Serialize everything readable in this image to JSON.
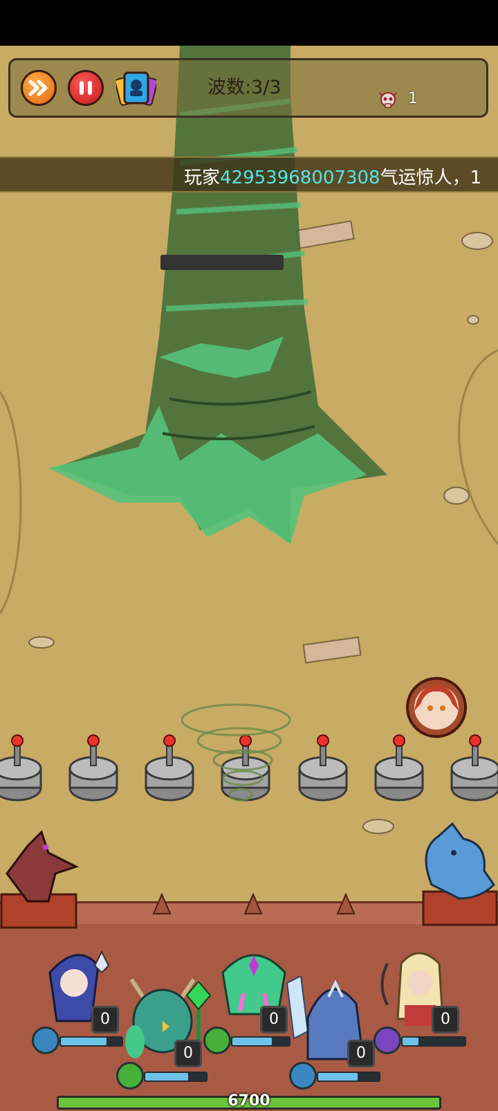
{
  "hud": {
    "wave_label": "波数:3/3",
    "kill_count": "1"
  },
  "ticker": {
    "prefix": "玩家",
    "player_id": "42953968007308",
    "suffix": "气运惊人，",
    "tail": "1"
  },
  "heroes": [
    {
      "name": "mage",
      "count": "0",
      "mana": 0.75
    },
    {
      "name": "antler-beast",
      "count": "0",
      "mana": 0.7
    },
    {
      "name": "spirit",
      "count": "0",
      "mana": 0.7
    },
    {
      "name": "ice-knight",
      "count": "0",
      "mana": 0.65
    },
    {
      "name": "elf-archer",
      "count": "0",
      "mana": 0.25
    }
  ],
  "base": {
    "hp": "6700",
    "hp_fraction": 1.0
  },
  "colors": {
    "accent_cyan": "#53e6e6",
    "hp_green": "#6cc43a"
  }
}
